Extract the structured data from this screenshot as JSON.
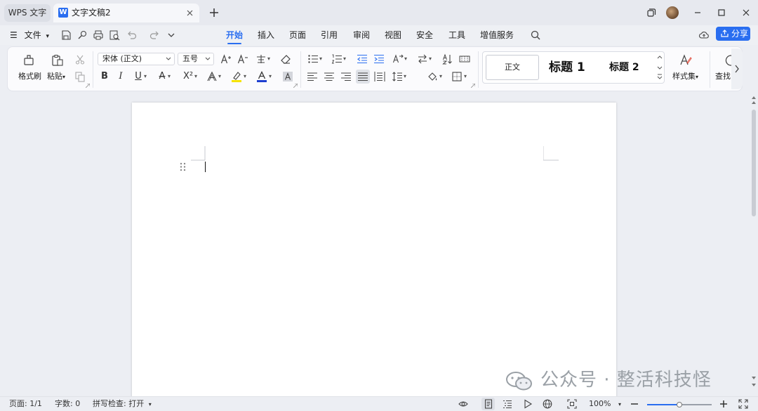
{
  "titlebar": {
    "app_tab": "WPS 文字",
    "doc_tab": "文字文稿2",
    "doc_logo_letter": "W"
  },
  "menu": {
    "file": "文件",
    "tabs": [
      {
        "label": "开始",
        "active": true
      },
      {
        "label": "插入"
      },
      {
        "label": "页面"
      },
      {
        "label": "引用"
      },
      {
        "label": "审阅"
      },
      {
        "label": "视图"
      },
      {
        "label": "安全"
      },
      {
        "label": "工具"
      },
      {
        "label": "增值服务"
      }
    ],
    "share": "分享"
  },
  "ribbon": {
    "format_painter": "格式刷",
    "paste": "粘贴",
    "font_name": "宋体 (正文)",
    "font_size": "五号",
    "styles": {
      "normal": "正文",
      "heading1": "标题 1",
      "heading2": "标题 2"
    },
    "style_set": "样式集",
    "find": "查找"
  },
  "statusbar": {
    "page": "页面: 1/1",
    "words": "字数: 0",
    "spellcheck": "拼写检查: 打开",
    "zoom": "100%",
    "zoom_level": 0.5
  },
  "watermark": {
    "text": "公众号 · 整活科技怪"
  },
  "colors": {
    "accent": "#2a6ef0",
    "highlight": "#f5e300",
    "font_color": "#1f3fd0"
  }
}
